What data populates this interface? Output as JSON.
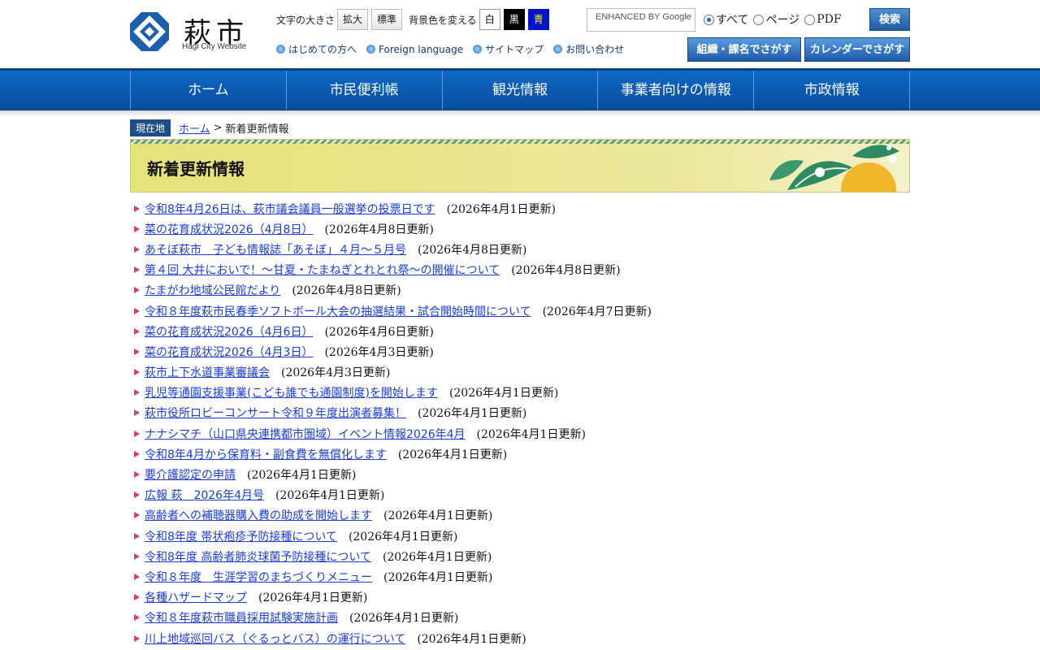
{
  "header": {
    "logo_name": "萩市",
    "logo_sub": "Hagi City Website",
    "font_size_label": "文字の大きさ",
    "font_size_buttons": [
      "拡大",
      "標準"
    ],
    "bg_color_label": "背景色を変える",
    "bg_color_buttons": [
      "白",
      "黒",
      "青"
    ],
    "quick_links": [
      "はじめての方へ",
      "Foreign language",
      "サイトマップ",
      "お問い合わせ"
    ],
    "search_placeholder": "ENHANCED BY Google",
    "search_scopes": [
      "すべて",
      "ページ",
      "PDF"
    ],
    "search_scope_selected": "すべて",
    "search_button": "検索",
    "org_search_button": "組織・課名でさがす",
    "calendar_search_button": "カレンダーでさがす"
  },
  "gnav": [
    "ホーム",
    "市民便利帳",
    "観光情報",
    "事業者向けの情報",
    "市政情報"
  ],
  "breadcrumb": {
    "label": "現在地",
    "home": "ホーム",
    "separator": ">",
    "current": "新着更新情報"
  },
  "page_title": "新着更新情報",
  "news": [
    {
      "title": "令和8年4月26日は、萩市議会議員一般選挙の投票日です",
      "date": "(2026年4月1日更新)"
    },
    {
      "title": "菜の花育成状況2026（4月8日）",
      "date": "(2026年4月8日更新)"
    },
    {
      "title": "あそぼ萩市　子ども情報誌「あそぼ」４月～５月号",
      "date": "(2026年4月8日更新)"
    },
    {
      "title": "第４回 大井においで！～甘夏・たまねぎとれとれ祭～の開催について",
      "date": "(2026年4月8日更新)"
    },
    {
      "title": "たまがわ地域公民館だより",
      "date": "(2026年4月8日更新)"
    },
    {
      "title": "令和８年度萩市民春季ソフトボール大会の抽選結果・試合開始時間について",
      "date": "(2026年4月7日更新)"
    },
    {
      "title": "菜の花育成状況2026（4月6日）",
      "date": "(2026年4月6日更新)"
    },
    {
      "title": "菜の花育成状況2026（4月3日）",
      "date": "(2026年4月3日更新)"
    },
    {
      "title": "萩市上下水道事業審議会",
      "date": "(2026年4月3日更新)"
    },
    {
      "title": "乳児等通園支援事業(こども誰でも通園制度)を開始します",
      "date": "(2026年4月1日更新)"
    },
    {
      "title": "萩市役所ロビーコンサート令和９年度出演者募集！",
      "date": "(2026年4月1日更新)"
    },
    {
      "title": "ナナシマチ（山口県央連携都市圏域）イベント情報2026年4月",
      "date": "(2026年4月1日更新)"
    },
    {
      "title": "令和8年4月から保育料・副食費を無償化します",
      "date": "(2026年4月1日更新)"
    },
    {
      "title": "要介護認定の申請",
      "date": "(2026年4月1日更新)"
    },
    {
      "title": "広報 萩　2026年4月号",
      "date": "(2026年4月1日更新)"
    },
    {
      "title": "高齢者への補聴器購入費の助成を開始します",
      "date": "(2026年4月1日更新)"
    },
    {
      "title": "令和8年度 帯状疱疹予防接種について",
      "date": "(2026年4月1日更新)"
    },
    {
      "title": "令和8年度 高齢者肺炎球菌予防接種について",
      "date": "(2026年4月1日更新)"
    },
    {
      "title": "令和８年度　生涯学習のまちづくりメニュー",
      "date": "(2026年4月1日更新)"
    },
    {
      "title": "各種ハザードマップ",
      "date": "(2026年4月1日更新)"
    },
    {
      "title": "令和８年度萩市職員採用試験実施計画",
      "date": "(2026年4月1日更新)"
    },
    {
      "title": "川上地域巡回バス（ぐるっとバス）の運行について",
      "date": "(2026年4月1日更新)"
    }
  ],
  "colors": {
    "nav_blue": "#0a5ab0",
    "link_blue": "#1a3ed6",
    "bullet_pink": "#e0386a",
    "title_yellow": "#e6e27a"
  }
}
